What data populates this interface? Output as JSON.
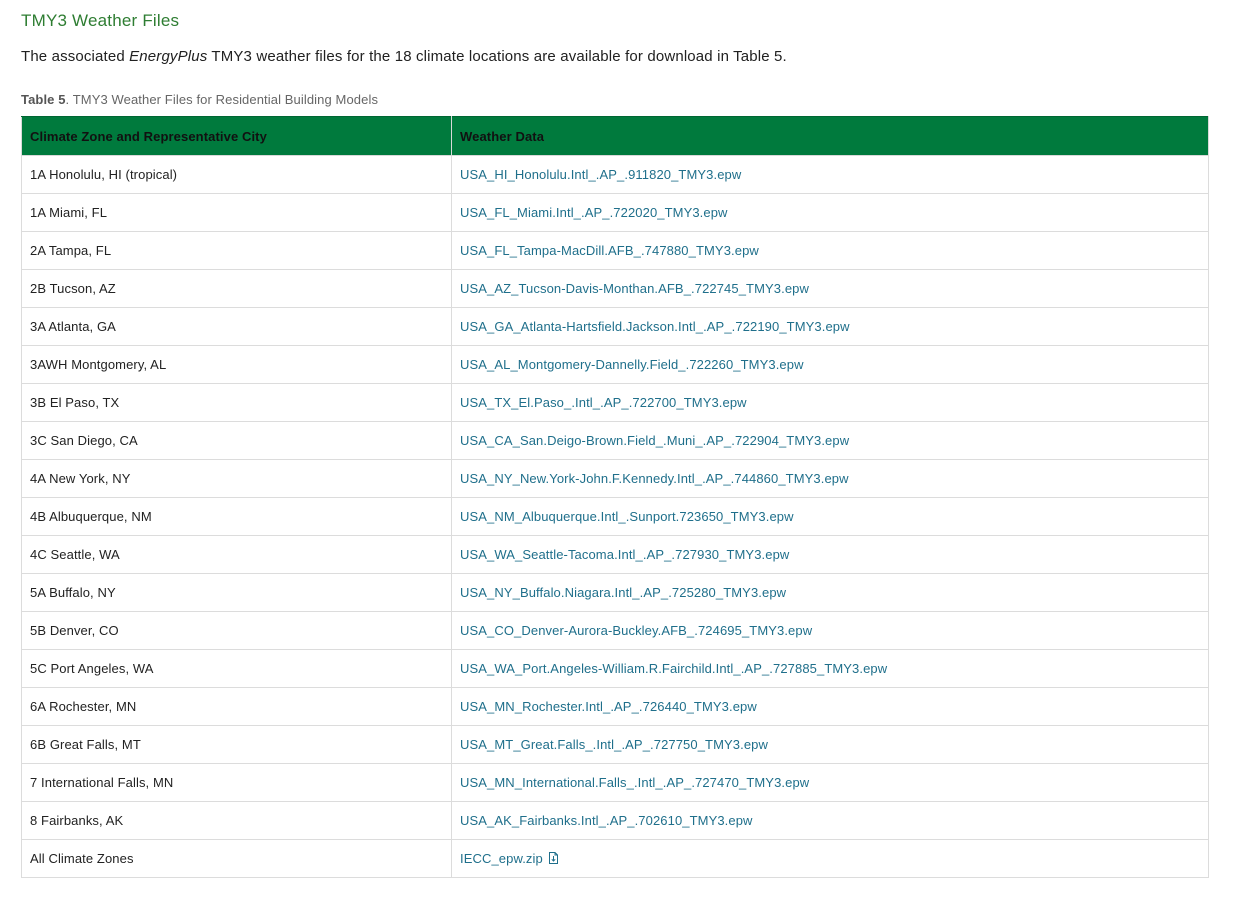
{
  "section": {
    "title": "TMY3 Weather Files"
  },
  "intro": {
    "before": "The associated ",
    "emphasis": "EnergyPlus",
    "after": " TMY3 weather files for the 18 climate locations are available for download in Table 5."
  },
  "caption": {
    "label": "Table 5",
    "text": ". TMY3 Weather Files for Residential Building Models"
  },
  "table": {
    "headers": [
      "Climate Zone and Representative City",
      "Weather Data"
    ],
    "rows": [
      {
        "city": "1A Honolulu, HI (tropical)",
        "file": "USA_HI_Honolulu.Intl_.AP_.911820_TMY3.epw"
      },
      {
        "city": "1A Miami, FL",
        "file": "USA_FL_Miami.Intl_.AP_.722020_TMY3.epw"
      },
      {
        "city": "2A Tampa, FL",
        "file": "USA_FL_Tampa-MacDill.AFB_.747880_TMY3.epw"
      },
      {
        "city": "2B Tucson, AZ",
        "file": "USA_AZ_Tucson-Davis-Monthan.AFB_.722745_TMY3.epw"
      },
      {
        "city": "3A Atlanta, GA",
        "file": "USA_GA_Atlanta-Hartsfield.Jackson.Intl_.AP_.722190_TMY3.epw"
      },
      {
        "city": "3AWH Montgomery, AL",
        "file": "USA_AL_Montgomery-Dannelly.Field_.722260_TMY3.epw"
      },
      {
        "city": "3B El Paso, TX",
        "file": "USA_TX_El.Paso_.Intl_.AP_.722700_TMY3.epw"
      },
      {
        "city": "3C San Diego, CA",
        "file": "USA_CA_San.Deigo-Brown.Field_.Muni_.AP_.722904_TMY3.epw"
      },
      {
        "city": "4A New York, NY",
        "file": "USA_NY_New.York-John.F.Kennedy.Intl_.AP_.744860_TMY3.epw"
      },
      {
        "city": "4B Albuquerque, NM",
        "file": "USA_NM_Albuquerque.Intl_.Sunport.723650_TMY3.epw"
      },
      {
        "city": "4C Seattle, WA",
        "file": "USA_WA_Seattle-Tacoma.Intl_.AP_.727930_TMY3.epw"
      },
      {
        "city": "5A Buffalo, NY",
        "file": "USA_NY_Buffalo.Niagara.Intl_.AP_.725280_TMY3.epw"
      },
      {
        "city": "5B Denver, CO",
        "file": "USA_CO_Denver-Aurora-Buckley.AFB_.724695_TMY3.epw"
      },
      {
        "city": "5C Port Angeles, WA",
        "file": "USA_WA_Port.Angeles-William.R.Fairchild.Intl_.AP_.727885_TMY3.epw"
      },
      {
        "city": "6A Rochester, MN",
        "file": "USA_MN_Rochester.Intl_.AP_.726440_TMY3.epw"
      },
      {
        "city": "6B Great Falls, MT",
        "file": "USA_MT_Great.Falls_.Intl_.AP_.727750_TMY3.epw"
      },
      {
        "city": "7 International Falls, MN",
        "file": "USA_MN_International.Falls_.Intl_.AP_.727470_TMY3.epw"
      },
      {
        "city": "8 Fairbanks, AK",
        "file": "USA_AK_Fairbanks.Intl_.AP_.702610_TMY3.epw"
      },
      {
        "city": "All Climate Zones",
        "file": "IECC_epw.zip",
        "icon": "file-download-icon"
      }
    ]
  },
  "colors": {
    "heading_green": "#2e7d32",
    "header_bg": "#007a3d",
    "link": "#1f6f8b"
  }
}
